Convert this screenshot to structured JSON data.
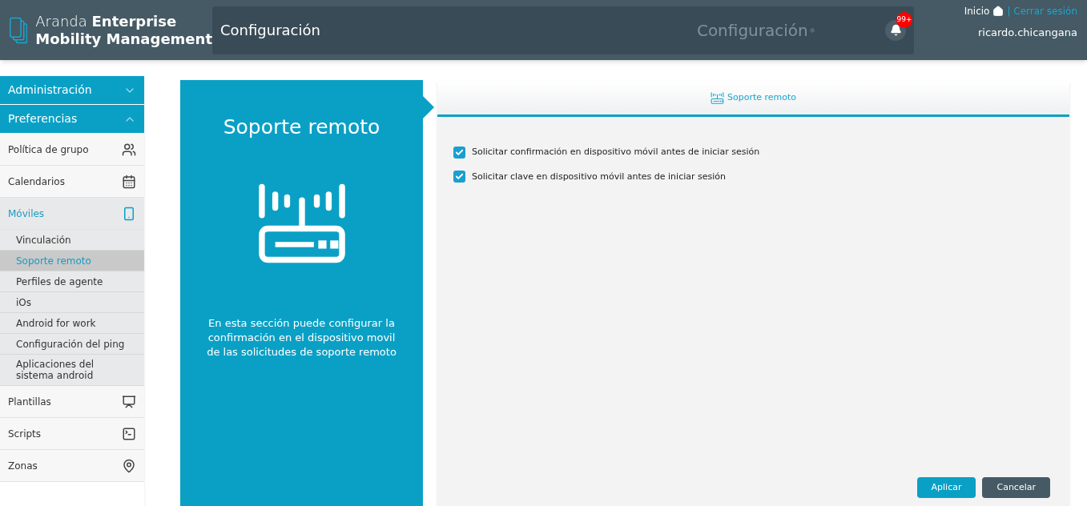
{
  "header": {
    "brand_light": "Aranda",
    "brand_bold": "Enterprise",
    "brand_line2": "Mobility Management",
    "page_title": "Configuración",
    "ghost_title": "Configuración",
    "notifications": "99+",
    "home_link": "Inicio",
    "logout_link": "| Cerrar sesión",
    "user": "ricardo.chicangana"
  },
  "sidebar": [
    {
      "label": "Administración",
      "expanded": false
    },
    {
      "label": "Preferencias",
      "expanded": true,
      "children": [
        {
          "label": "Política de grupo",
          "selected": false
        },
        {
          "label": "Calendarios",
          "selected": false
        },
        {
          "label": "Móviles",
          "selected": true,
          "children": [
            {
              "label": "Vinculación",
              "selected": false
            },
            {
              "label": "Soporte remoto",
              "selected": true
            },
            {
              "label": "Perfiles de agente",
              "selected": false
            },
            {
              "label": "iOs",
              "selected": false
            },
            {
              "label": "Android for work",
              "selected": false
            },
            {
              "label": "Configuración del ping",
              "selected": false
            },
            {
              "label": "Aplicaciones del sistema android",
              "selected": false
            }
          ]
        },
        {
          "label": "Plantillas",
          "selected": false
        },
        {
          "label": "Scripts",
          "selected": false
        },
        {
          "label": "Zonas",
          "selected": false
        }
      ]
    }
  ],
  "info_panel": {
    "title": "Soporte remoto",
    "description": "En esta sección puede configurar la confirmación en el dispositivo movil de las solicitudes de soporte remoto"
  },
  "settings": {
    "tab": "Soporte remoto",
    "options": [
      {
        "label": "Solicitar confirmación en dispositivo móvil antes de iniciar sesión",
        "checked": true
      },
      {
        "label": "Solicitar clave en dispositivo móvil antes de iniciar sesión",
        "checked": true
      }
    ],
    "buttons": [
      {
        "label": "Aplicar",
        "kind": "primary"
      },
      {
        "label": "Cancelar",
        "kind": "secondary"
      }
    ]
  }
}
